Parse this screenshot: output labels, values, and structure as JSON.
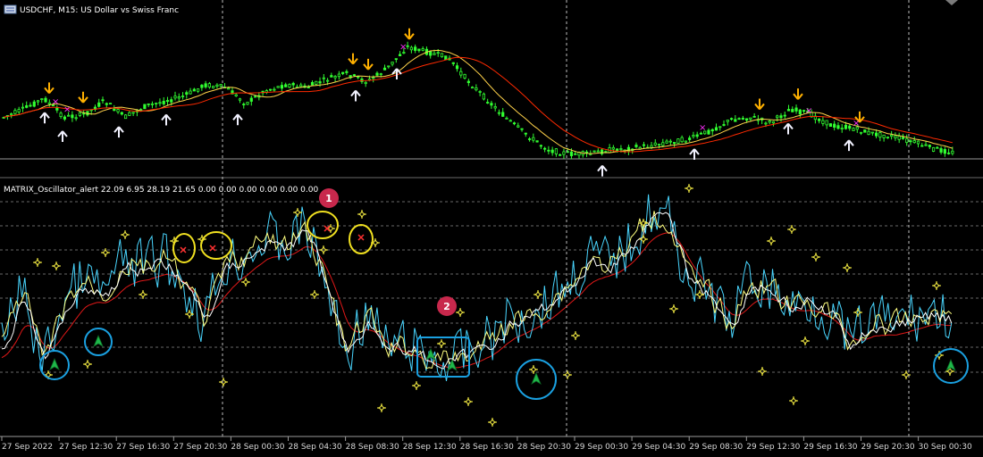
{
  "window": {
    "title": "USDCHF, M15:  US Dollar vs Swiss Franc",
    "menu_icon": "chart-window-icon"
  },
  "indicator": {
    "label": "MATRIX_Oscillator_alert 22.09 6.95 28.19 21.65 0.00 0.00 0.00 0.00 0.00 0.00"
  },
  "annotations": {
    "badge_1": "1",
    "badge_2": "2"
  },
  "colors": {
    "background": "#000000",
    "candle": "#31ff31",
    "ma_red": "#ff2a00",
    "ma_yellow": "#ffd24a",
    "arrow_up": "#f2f2ff",
    "arrow_down": "#ffb000",
    "marker_magenta": "#ff30ff",
    "osc_cyan": "#49d6ff",
    "osc_white": "#ffffff",
    "osc_yellow": "#ffff80",
    "osc_red": "#e01818",
    "star": "#e8e040",
    "circle_yellow": "#f0e020",
    "circle_blue": "#1aa0e0",
    "badge": "#c8284c",
    "grid": "#8a8a8a"
  },
  "chart_data": {
    "type": "line",
    "panes": [
      "price",
      "oscillator"
    ],
    "time_labels": [
      "27 Sep 2022",
      "27 Sep 12:30",
      "27 Sep 16:30",
      "27 Sep 20:30",
      "28 Sep 00:30",
      "28 Sep 04:30",
      "28 Sep 08:30",
      "28 Sep 12:30",
      "28 Sep 16:30",
      "28 Sep 20:30",
      "29 Sep 00:30",
      "29 Sep 04:30",
      "29 Sep 08:30",
      "29 Sep 12:30",
      "29 Sep 16:30",
      "29 Sep 20:30",
      "30 Sep 00:30"
    ],
    "price_shape": [
      0.72,
      0.66,
      0.58,
      0.72,
      0.7,
      0.6,
      0.72,
      0.64,
      0.6,
      0.56,
      0.48,
      0.5,
      0.62,
      0.52,
      0.48,
      0.5,
      0.44,
      0.4,
      0.46,
      0.36,
      0.2,
      0.24,
      0.28,
      0.45,
      0.6,
      0.74,
      0.86,
      0.96,
      0.99,
      0.99,
      0.96,
      0.95,
      0.93,
      0.9,
      0.88,
      0.82,
      0.74,
      0.72,
      0.76,
      0.66,
      0.7,
      0.78,
      0.8,
      0.84,
      0.86,
      0.9,
      0.95,
      0.98
    ],
    "oscillator_shape": [
      0.3,
      0.58,
      0.2,
      0.5,
      0.62,
      0.55,
      0.7,
      0.68,
      0.72,
      0.6,
      0.42,
      0.7,
      0.74,
      0.82,
      0.78,
      0.88,
      0.6,
      0.25,
      0.46,
      0.28,
      0.3,
      0.24,
      0.22,
      0.26,
      0.32,
      0.42,
      0.44,
      0.52,
      0.6,
      0.72,
      0.7,
      0.78,
      0.95,
      0.9,
      0.62,
      0.55,
      0.4,
      0.62,
      0.58,
      0.48,
      0.52,
      0.45,
      0.3,
      0.42,
      0.4,
      0.44,
      0.46,
      0.44
    ]
  }
}
